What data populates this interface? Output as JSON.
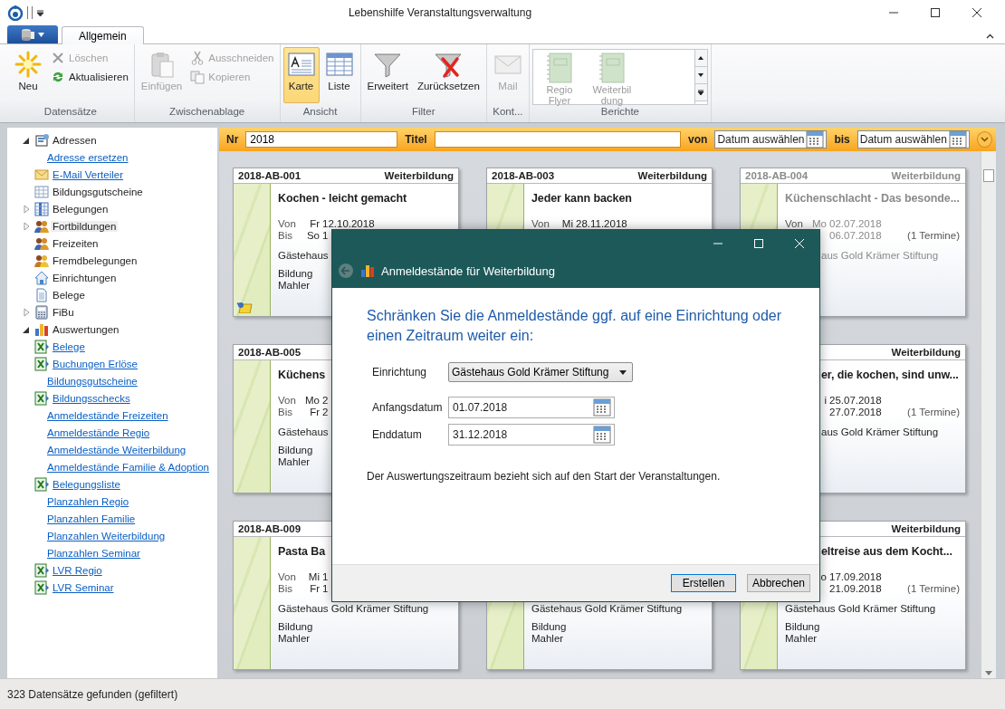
{
  "window": {
    "title": "Lebenshilfe Veranstaltungsverwaltung"
  },
  "ribbon": {
    "tabs": [
      {
        "label": "Allgemein",
        "selected": true
      }
    ],
    "groups": [
      {
        "label": "Datensätze",
        "items": [
          {
            "label": "Neu",
            "kind": "new",
            "disabled": false
          },
          {
            "label": "Löschen",
            "kind": "delete",
            "disabled": true
          },
          {
            "label": "Aktualisieren",
            "kind": "refresh",
            "disabled": false
          }
        ]
      },
      {
        "label": "Zwischenablage",
        "items": [
          {
            "label": "Einfügen",
            "kind": "paste",
            "disabled": true
          },
          {
            "label": "Ausschneiden",
            "kind": "cut",
            "disabled": true
          },
          {
            "label": "Kopieren",
            "kind": "copy",
            "disabled": true
          }
        ]
      },
      {
        "label": "Ansicht",
        "items": [
          {
            "label": "Karte",
            "kind": "card",
            "disabled": false,
            "selected": true
          },
          {
            "label": "Liste",
            "kind": "list",
            "disabled": false,
            "selected": false
          }
        ]
      },
      {
        "label": "Filter",
        "items": [
          {
            "label": "Erweitert",
            "kind": "filter",
            "disabled": false
          },
          {
            "label": "Zurücksetzen",
            "kind": "filter-reset",
            "disabled": false
          }
        ]
      },
      {
        "label": "Kont...",
        "items": [
          {
            "label": "Mail",
            "kind": "mail",
            "disabled": true
          }
        ]
      },
      {
        "label": "Berichte",
        "items": [
          {
            "label": "Regio Flyer",
            "kind": "report",
            "disabled": true
          },
          {
            "label": "Weiterbildung",
            "kind": "report",
            "disabled": true
          }
        ]
      }
    ]
  },
  "sidebar": {
    "items": [
      {
        "label": "Adressen",
        "kind": "addresses",
        "expanded": true,
        "children": [
          {
            "label": "Adresse ersetzen",
            "kind": "link"
          },
          {
            "label": "E-Mail Verteiler",
            "kind": "mail-link"
          },
          {
            "label": "Bildungsgutscheine",
            "kind": "table"
          }
        ]
      },
      {
        "label": "Belegungen",
        "kind": "bookings",
        "expanded": false,
        "selected": false
      },
      {
        "label": "Fortbildungen",
        "kind": "people",
        "expanded": false,
        "selected": true
      },
      {
        "label": "Freizeiten",
        "kind": "people",
        "selected": false
      },
      {
        "label": "Fremdbelegungen",
        "kind": "people-yellow",
        "selected": false
      },
      {
        "label": "Einrichtungen",
        "kind": "house",
        "selected": false
      },
      {
        "label": "Belege",
        "kind": "document",
        "selected": false
      },
      {
        "label": "FiBu",
        "kind": "calculator",
        "expanded": false,
        "selected": false
      },
      {
        "label": "Auswertungen",
        "kind": "chart",
        "expanded": true,
        "children": [
          {
            "label": "Belege",
            "kind": "excel-link"
          },
          {
            "label": "Buchungen Erlöse",
            "kind": "excel-link"
          },
          {
            "label": "Bildungsgutscheine",
            "kind": "link"
          },
          {
            "label": "Bildungsschecks",
            "kind": "excel-link"
          },
          {
            "label": "Anmeldestände Freizeiten",
            "kind": "link"
          },
          {
            "label": "Anmeldestände Regio",
            "kind": "link"
          },
          {
            "label": "Anmeldestände Weiterbildung",
            "kind": "link"
          },
          {
            "label": "Anmeldestände Familie & Adoption",
            "kind": "link"
          },
          {
            "label": "Belegungsliste",
            "kind": "excel-link"
          },
          {
            "label": "Planzahlen Regio",
            "kind": "link"
          },
          {
            "label": "Planzahlen Familie",
            "kind": "link"
          },
          {
            "label": "Planzahlen Weiterbildung",
            "kind": "link"
          },
          {
            "label": "Planzahlen Seminar",
            "kind": "link"
          },
          {
            "label": "LVR Regio",
            "kind": "excel-link"
          },
          {
            "label": "LVR Seminar",
            "kind": "excel-link"
          }
        ]
      }
    ]
  },
  "filter_bar": {
    "number_label": "Nr",
    "number_value": "2018",
    "title_label": "Titel",
    "from_label": "von",
    "from_placeholder": "Datum auswählen",
    "to_label": "bis",
    "to_placeholder": "Datum auswählen"
  },
  "cards": [
    {
      "id": "2018-AB-001",
      "category": "Weiterbildung",
      "title": "Kochen - leicht gemacht",
      "von_label": "Von",
      "von_day": "Fr",
      "von_date": "12.10.2018",
      "bis_label": "Bis",
      "bis_day": "So",
      "bis_date": "1",
      "place": "Gästehaus",
      "type": "Bildung",
      "person": "Mahler",
      "pinned": true,
      "inactive": false
    },
    {
      "id": "2018-AB-003",
      "category": "Weiterbildung",
      "title": "Jeder kann backen",
      "von_label": "Von",
      "von_day": "Mi",
      "von_date": "28.11.2018",
      "inactive": false
    },
    {
      "id": "2018-AB-004",
      "category": "Weiterbildung",
      "title": "Küchenschlacht - Das besonde...",
      "von_label": "Von",
      "von_day": "Mo",
      "von_date": "02.07.2018",
      "bis_date": "06.07.2018",
      "appointments": "(1 Termine)",
      "place": "aus Gold Krämer Stiftung",
      "place_cut_left": true,
      "inactive": true
    },
    {
      "id": "2018-AB-005",
      "title": "Küchens",
      "von_label": "Von",
      "von_day": "Mo",
      "von_date": "2",
      "bis_label": "Bis",
      "bis_day": "Fr",
      "bis_date": "2",
      "place": "Gästehaus",
      "type": "Bildung",
      "person": "Mahler",
      "inactive": false
    },
    {
      "category": "Weiterbildung",
      "title": "er, die kochen, sind unw...",
      "von_day": "i",
      "von_date": "25.07.2018",
      "bis_date": "27.07.2018",
      "appointments": "(1 Termine)",
      "place": "aus Gold Krämer Stiftung",
      "title_cut_left": true,
      "place_cut_left": true,
      "inactive": false
    },
    {
      "id": "2018-AB-009",
      "title": "Pasta Ba",
      "von_label": "Von",
      "von_day": "Mi",
      "von_date": "1",
      "bis_label": "Bis",
      "bis_day": "Fr",
      "bis_date": "1",
      "place": "Gästehaus Gold Krämer Stiftung",
      "type": "Bildung",
      "person": "Mahler",
      "inactive": false
    },
    {
      "place": "Gästehaus Gold Krämer Stiftung",
      "type": "Bildung",
      "person": "Mahler",
      "inactive": false
    },
    {
      "category": "Weiterbildung",
      "title": "eltreise aus dem Kocht...",
      "von_day": "o",
      "von_date": "17.09.2018",
      "bis_date": "21.09.2018",
      "appointments": "(1 Termine)",
      "place": "Gästehaus Gold Krämer Stiftung",
      "type": "Bildung",
      "person": "Mahler",
      "title_cut_left": true,
      "inactive": false
    }
  ],
  "dialog": {
    "title": "Anmeldestände für Weiterbildung",
    "heading": "Schränken Sie die Anmeldestände ggf. auf eine Einrichtung oder einen Zeitraum weiter ein:",
    "fields": [
      {
        "label": "Einrichtung",
        "kind": "combo",
        "value": "Gästehaus Gold Krämer Stiftung"
      },
      {
        "label": "Anfangsdatum",
        "kind": "date",
        "value": "01.07.2018"
      },
      {
        "label": "Enddatum",
        "kind": "date",
        "value": "31.12.2018"
      }
    ],
    "note": "Der Auswertungszeitraum bezieht sich auf den Start der Veranstaltungen.",
    "buttons": [
      {
        "label": "Erstellen",
        "default": true
      },
      {
        "label": "Abbrechen",
        "default": false
      }
    ]
  },
  "status_bar": {
    "text": "323 Datensätze gefunden (gefiltert)"
  }
}
